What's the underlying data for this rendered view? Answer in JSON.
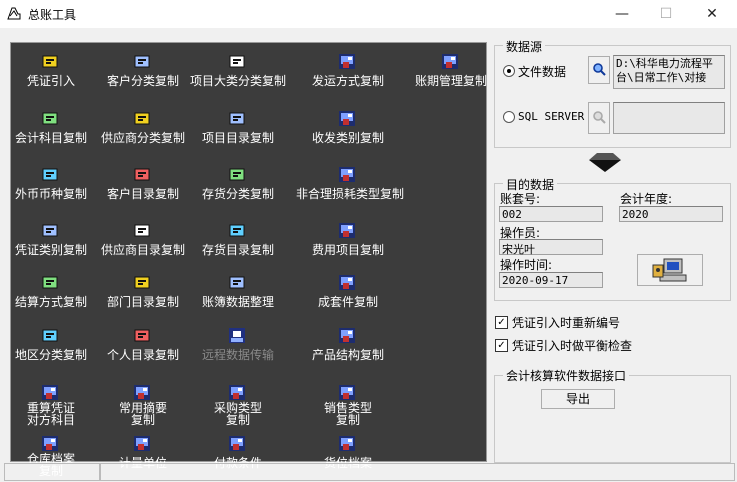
{
  "window": {
    "title": "总账工具",
    "minimize": "—",
    "maximize": "☐",
    "close": "✕"
  },
  "tools": [
    {
      "label": "凭证引入",
      "icon": "voucher-import-icon"
    },
    {
      "label": "客户分类复制",
      "icon": "customer-category-icon"
    },
    {
      "label": "项目大类分类复制",
      "icon": "project-category-icon"
    },
    {
      "label": "发运方式复制",
      "icon": "generic-tool-icon"
    },
    {
      "label": "账期管理复制",
      "icon": "generic-tool-icon"
    },
    {
      "label": "会计科目复制",
      "icon": "account-subject-icon"
    },
    {
      "label": "供应商分类复制",
      "icon": "supplier-category-icon"
    },
    {
      "label": "项目目录复制",
      "icon": "project-list-icon"
    },
    {
      "label": "收发类别复制",
      "icon": "generic-tool-icon"
    },
    {
      "label": "外币币种复制",
      "icon": "currency-icon"
    },
    {
      "label": "客户目录复制",
      "icon": "customer-list-icon"
    },
    {
      "label": "存货分类复制",
      "icon": "inventory-category-icon"
    },
    {
      "label": "非合理损耗类型复制",
      "icon": "generic-tool-icon"
    },
    {
      "label": "凭证类别复制",
      "icon": "voucher-type-icon"
    },
    {
      "label": "供应商目录复制",
      "icon": "supplier-list-icon"
    },
    {
      "label": "存货目录复制",
      "icon": "inventory-list-icon"
    },
    {
      "label": "费用项目复制",
      "icon": "generic-tool-icon"
    },
    {
      "label": "结算方式复制",
      "icon": "settlement-icon"
    },
    {
      "label": "部门目录复制",
      "icon": "department-icon"
    },
    {
      "label": "账簿数据整理",
      "icon": "ledger-cleanup-icon"
    },
    {
      "label": "成套件复制",
      "icon": "generic-tool-icon"
    },
    {
      "label": "地区分类复制",
      "icon": "region-icon"
    },
    {
      "label": "个人目录复制",
      "icon": "personal-list-icon"
    },
    {
      "label": "远程数据传输",
      "icon": "remote-transfer-icon"
    },
    {
      "label": "产品结构复制",
      "icon": "generic-tool-icon"
    },
    {
      "label": "重算凭证\n对方科目",
      "icon": "generic-tool-icon"
    },
    {
      "label": "常用摘要\n复制",
      "icon": "generic-tool-icon"
    },
    {
      "label": "采购类型\n复制",
      "icon": "generic-tool-icon"
    },
    {
      "label": "销售类型\n复制",
      "icon": "generic-tool-icon"
    },
    {
      "label": "仓库档案\n复制",
      "icon": "generic-tool-icon"
    },
    {
      "label": "计量单位",
      "icon": "generic-tool-icon"
    },
    {
      "label": "付款条件",
      "icon": "generic-tool-icon"
    },
    {
      "label": "货位档案",
      "icon": "generic-tool-icon"
    }
  ],
  "datasource": {
    "group_title": "数据源",
    "file_label": "文件数据",
    "file_selected": true,
    "file_path": "D:\\科华电力流程平台\\日常工作\\对接",
    "sql_label": "SQL SERVER",
    "sql_selected": false,
    "sql_value": "",
    "browse_icon": "magnifier-icon",
    "arrow_icon": "down-arrow-icon"
  },
  "target": {
    "group_title": "目的数据",
    "account_set_label": "账套号:",
    "account_set_value": "002",
    "year_label": "会计年度:",
    "year_value": "2020",
    "operator_label": "操作员:",
    "operator_value": "宋光叶",
    "optime_label": "操作时间:",
    "optime_value": "2020-09-17",
    "run_icon": "computer-run-icon"
  },
  "options": [
    {
      "label": "凭证引入时重新编号",
      "checked": true
    },
    {
      "label": "凭证引入时做平衡检查",
      "checked": true
    }
  ],
  "interface": {
    "group_title": "会计核算软件数据接口",
    "export_label": "导出"
  }
}
